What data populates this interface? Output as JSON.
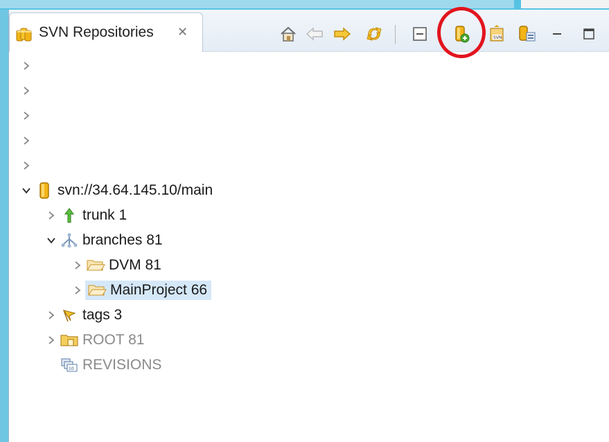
{
  "view": {
    "title": "SVN Repositories",
    "close_glyph": "✕"
  },
  "toolbar": [
    {
      "icon": "home-icon"
    },
    {
      "icon": "back-arrow-icon"
    },
    {
      "icon": "forward-arrow-icon"
    },
    {
      "icon": "refresh-icon"
    },
    {
      "icon": "collapse-all-icon"
    },
    {
      "icon": "new-repository-location-icon",
      "highlighted": true
    },
    {
      "icon": "import-svn-icon"
    },
    {
      "icon": "checkout-icon"
    },
    {
      "icon": "minimize-icon"
    },
    {
      "icon": "maximize-icon"
    }
  ],
  "tree": {
    "collapsed_rows": 5,
    "repository": {
      "url": "svn://34.64.145.10/main",
      "expanded": true,
      "children": [
        {
          "label": "trunk 1",
          "icon": "trunk-arrow-icon",
          "expanded": false
        },
        {
          "label": "branches 81",
          "icon": "branches-icon",
          "expanded": true,
          "children": [
            {
              "label": "DVM 81",
              "icon": "folder-open-icon",
              "expanded": false
            },
            {
              "label": "MainProject 66",
              "icon": "folder-open-icon",
              "expanded": false,
              "selected": true
            }
          ]
        },
        {
          "label": "tags 3",
          "icon": "tags-flag-icon",
          "expanded": false
        },
        {
          "label": "ROOT 81",
          "icon": "root-folder-icon",
          "expanded": false,
          "dimmed": true
        },
        {
          "label": "REVISIONS",
          "icon": "revisions-icon",
          "dimmed": true
        }
      ]
    }
  }
}
